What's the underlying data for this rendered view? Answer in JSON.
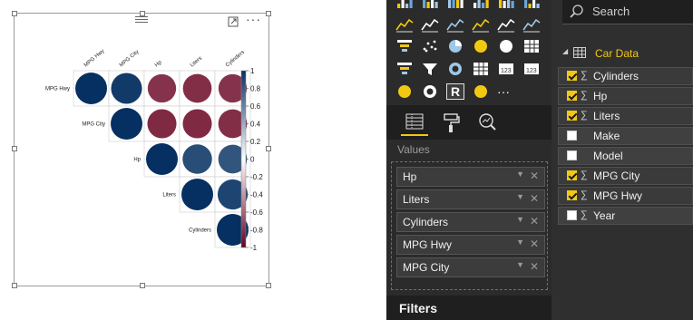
{
  "visual": {
    "more_label": "···",
    "corrplot": {
      "variables": [
        "MPG Hwy",
        "MPG City",
        "Hp",
        "Liters",
        "Cylinders"
      ],
      "matrix": [
        [
          1,
          0.95,
          -0.8,
          -0.82,
          -0.8
        ],
        [
          0.95,
          1,
          -0.84,
          -0.84,
          -0.82
        ],
        [
          -0.8,
          -0.84,
          1,
          0.86,
          0.82
        ],
        [
          -0.82,
          -0.84,
          0.86,
          1,
          0.9
        ],
        [
          -0.8,
          -0.82,
          0.82,
          0.9,
          1
        ]
      ],
      "colorbar_ticks": [
        "1",
        "0.8",
        "0.6",
        "0.4",
        "0.2",
        "0",
        "-0.2",
        "-0.4",
        "-0.6",
        "-0.8",
        "-1"
      ],
      "colors": {
        "positive": "#053061",
        "mid": "#ffffff",
        "negative": "#67001f",
        "grid": "#cccccc"
      }
    }
  },
  "viz_pane": {
    "icons": [
      "stacked-bar-icon",
      "stacked-column-icon",
      "clustered-bar-icon",
      "clustered-column-icon",
      "100-bar-icon",
      "100-column-icon",
      "line-chart-icon",
      "area-chart-icon",
      "stacked-area-icon",
      "line-column-icon",
      "line-clustered-icon",
      "ribbon-chart-icon",
      "waterfall-icon",
      "scatter-icon",
      "pie-chart-icon",
      "treemap-icon",
      "map-icon",
      "table-icon",
      "funnel-icon",
      "slicer-icon",
      "gauge-icon",
      "matrix-icon",
      "card-icon",
      "kpi-icon",
      "filled-map-icon",
      "donut-icon",
      "r-visual-icon",
      "shape-map-icon",
      "more-visuals-icon"
    ],
    "more_label": "···",
    "tabs": [
      "fields-tab-icon",
      "format-tab-icon",
      "analytics-tab-icon"
    ],
    "values_title": "Values",
    "values": [
      "Hp",
      "Liters",
      "Cylinders",
      "MPG Hwy",
      "MPG City"
    ],
    "filters_title": "Filters"
  },
  "fields_pane": {
    "search_placeholder": "Search",
    "table_name": "Car Data",
    "fields": [
      {
        "name": "Cylinders",
        "checked": true,
        "sigma": "∑"
      },
      {
        "name": "Hp",
        "checked": true,
        "sigma": "∑"
      },
      {
        "name": "Liters",
        "checked": true,
        "sigma": "∑"
      },
      {
        "name": "Make",
        "checked": false,
        "sigma": ""
      },
      {
        "name": "Model",
        "checked": false,
        "sigma": ""
      },
      {
        "name": "MPG City",
        "checked": true,
        "sigma": "∑"
      },
      {
        "name": "MPG Hwy",
        "checked": true,
        "sigma": "∑"
      },
      {
        "name": "Year",
        "checked": false,
        "sigma": "∑"
      }
    ]
  },
  "colors": {
    "accent": "#f2c811",
    "pane_dark": "#2b2b2b"
  }
}
